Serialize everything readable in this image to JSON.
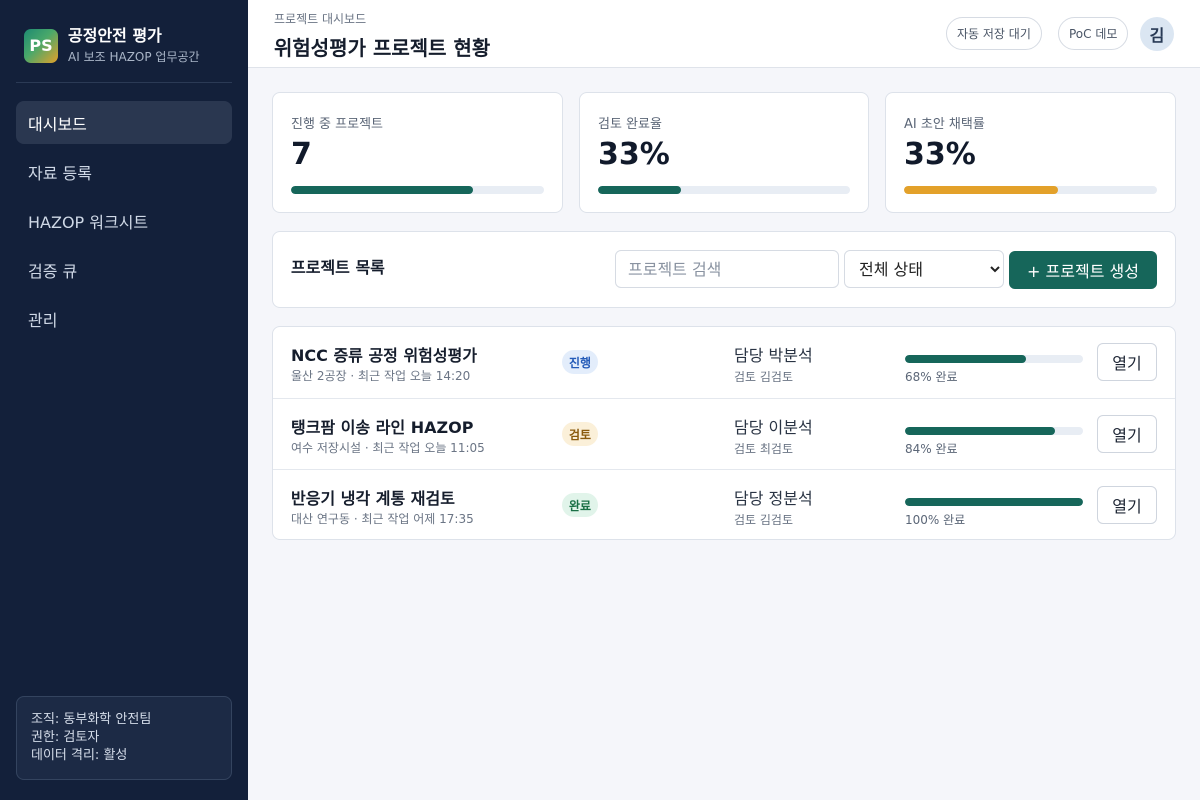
{
  "sidebar": {
    "logo_text": "PS",
    "brand_title": "공정안전 평가",
    "brand_subtitle": "AI 보조 HAZOP 업무공간",
    "nav": [
      "대시보드",
      "자료 등록",
      "HAZOP 워크시트",
      "검증 큐",
      "관리"
    ],
    "active_index": 0,
    "org": {
      "organization": "조직: 동부화학 안전팀",
      "role": "권한: 검토자",
      "isolation": "데이터 격리: 활성"
    }
  },
  "header": {
    "breadcrumb": "프로젝트 대시보드",
    "title": "위험성평가 프로젝트 현황",
    "autosave_label": "자동 저장 대기",
    "poc_label": "PoC 데모",
    "avatar_initial": "김"
  },
  "stats": [
    {
      "label": "진행 중 프로젝트",
      "value": "7",
      "bar_fraction": 0.72,
      "color": "#16665a"
    },
    {
      "label": "검토 완료율",
      "value": "33%",
      "bar_fraction": 0.33,
      "color": "#16665a"
    },
    {
      "label": "AI 초안 채택률",
      "value": "33%",
      "bar_fraction": 0.61,
      "color": "#e3a12a"
    }
  ],
  "project_list": {
    "title": "프로젝트 목록",
    "search_placeholder": "프로젝트 검색",
    "filter_selected": "전체 상태",
    "create_label": "+ 프로젝트 생성"
  },
  "projects": [
    {
      "name": "NCC 증류 공정 위험성평가",
      "meta": "울산 2공장 · 최근 작업 오늘 14:20",
      "status": "진행",
      "status_bg": "#e3edfb",
      "status_fg": "#245bb8",
      "owner": "담당 박분석",
      "reviewer": "검토 김검토",
      "progress": 0.68,
      "progress_label": "68% 완료",
      "open_label": "열기"
    },
    {
      "name": "탱크팜 이송 라인 HAZOP",
      "meta": "여수 저장시설 · 최근 작업 오늘 11:05",
      "status": "검토",
      "status_bg": "#fbf0d9",
      "status_fg": "#8a5a0c",
      "owner": "담당 이분석",
      "reviewer": "검토 최검토",
      "progress": 0.84,
      "progress_label": "84% 완료",
      "open_label": "열기"
    },
    {
      "name": "반응기 냉각 계통 재검토",
      "meta": "대산 연구동 · 최근 작업 어제 17:35",
      "status": "완료",
      "status_bg": "#e1f4ea",
      "status_fg": "#1a7046",
      "owner": "담당 정분석",
      "reviewer": "검토 김검토",
      "progress": 1.0,
      "progress_label": "100% 완료",
      "open_label": "열기"
    }
  ]
}
